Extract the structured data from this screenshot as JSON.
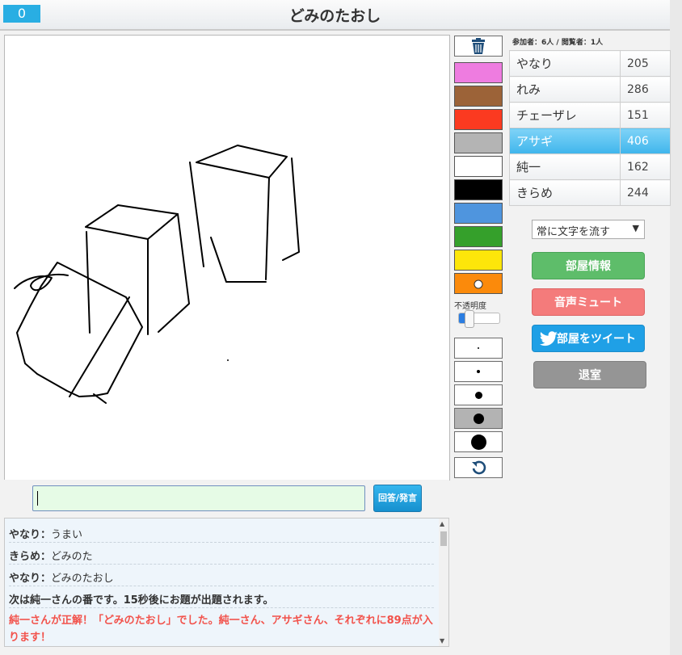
{
  "header": {
    "counter": "0",
    "title": "どみのたおし"
  },
  "toolbar": {
    "colors": [
      "#ee7ce0",
      "#9c6338",
      "#fb3a20",
      "#b4b4b4",
      "#ffffff",
      "#000000",
      "#4f95de",
      "#35a02b",
      "#fde60a",
      "#fb8a0b"
    ],
    "opacity_label": "不透明度",
    "opacity_value": 0.2
  },
  "room": {
    "participants": "参加者：6人 / 閲覧者：1人",
    "players": [
      {
        "name": "やなり",
        "score": "205"
      },
      {
        "name": "れみ",
        "score": "286"
      },
      {
        "name": "チェーザレ",
        "score": "151"
      },
      {
        "name": "アサギ",
        "score": "406"
      },
      {
        "name": "純一",
        "score": "162"
      },
      {
        "name": "きらめ",
        "score": "244"
      }
    ],
    "scroll_select": "常に文字を流す",
    "buttons": {
      "info": "部屋情報",
      "mute": "音声ミュート",
      "tweet": "部屋をツイート",
      "exit": "退室"
    }
  },
  "chat": {
    "submit_label": "回答/発言",
    "input_value": "",
    "messages": [
      {
        "name": "やなり",
        "sep": "：",
        "text": "うまい"
      },
      {
        "name": "きらめ",
        "sep": "：",
        "text": "どみのた"
      },
      {
        "name": "やなり",
        "sep": "：",
        "text": "どみのたおし"
      }
    ],
    "system_message": "次は純一さんの番です。15秒後にお題が出題されます。",
    "correct_message": "純一さんが正解！「どみのたおし」でした。純一さん、アサギさん、それぞれに89点が入ります！"
  }
}
